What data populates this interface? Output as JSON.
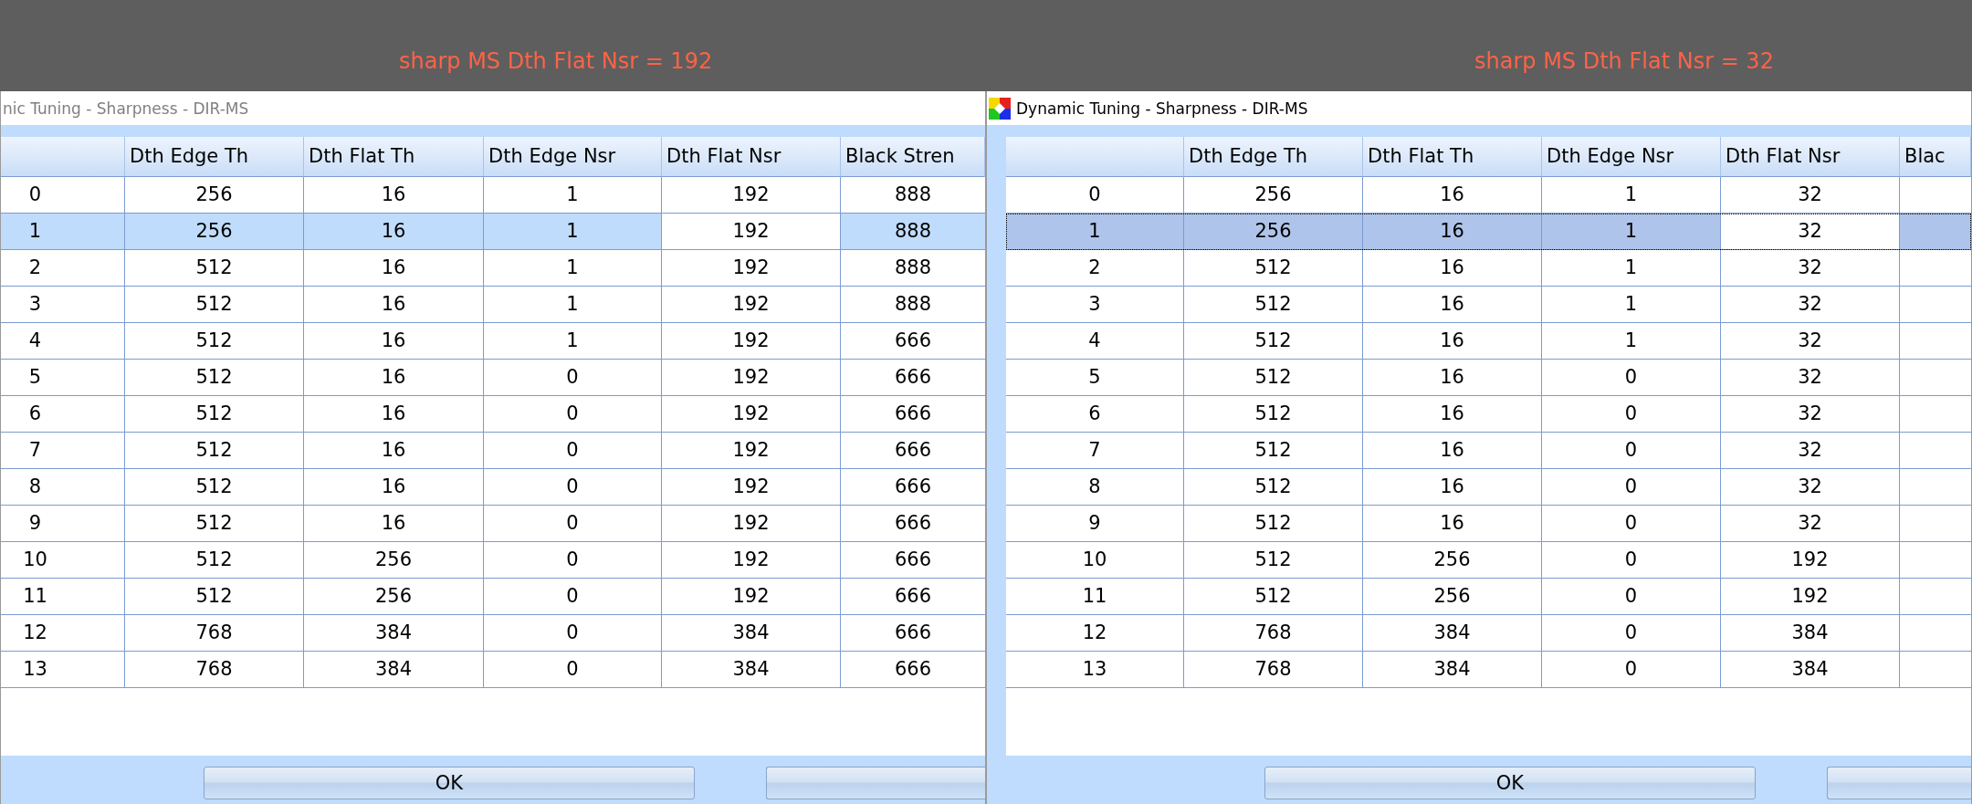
{
  "panels": [
    {
      "caption": "sharp MS Dth Flat Nsr = 192",
      "window": {
        "title": "nic Tuning - Sharpness - DIR-MS",
        "active": false,
        "app_icon": false
      },
      "table": {
        "columns": [
          {
            "label": "Dth Edge Th",
            "current": false
          },
          {
            "label": "Dth Flat Th",
            "current": false
          },
          {
            "label": "Dth Edge Nsr",
            "current": false
          },
          {
            "label": "Dth Flat Nsr",
            "current": true
          },
          {
            "label": "Black Stren",
            "current": false
          }
        ],
        "rows": [
          {
            "header": "0",
            "cells": [
              "256",
              "16",
              "1",
              "192",
              "888"
            ],
            "selected": false
          },
          {
            "header": "1",
            "cells": [
              "256",
              "16",
              "1",
              "192",
              "888"
            ],
            "selected": true
          },
          {
            "header": "2",
            "cells": [
              "512",
              "16",
              "1",
              "192",
              "888"
            ],
            "selected": false
          },
          {
            "header": "3",
            "cells": [
              "512",
              "16",
              "1",
              "192",
              "888"
            ],
            "selected": false
          },
          {
            "header": "4",
            "cells": [
              "512",
              "16",
              "1",
              "192",
              "666"
            ],
            "selected": false
          },
          {
            "header": "5",
            "cells": [
              "512",
              "16",
              "0",
              "192",
              "666"
            ],
            "selected": false
          },
          {
            "header": "6",
            "cells": [
              "512",
              "16",
              "0",
              "192",
              "666"
            ],
            "selected": false
          },
          {
            "header": "7",
            "cells": [
              "512",
              "16",
              "0",
              "192",
              "666"
            ],
            "selected": false
          },
          {
            "header": "8",
            "cells": [
              "512",
              "16",
              "0",
              "192",
              "666"
            ],
            "selected": false
          },
          {
            "header": "9",
            "cells": [
              "512",
              "16",
              "0",
              "192",
              "666"
            ],
            "selected": false
          },
          {
            "header": "10",
            "cells": [
              "512",
              "256",
              "0",
              "192",
              "666"
            ],
            "selected": false
          },
          {
            "header": "11",
            "cells": [
              "512",
              "256",
              "0",
              "192",
              "666"
            ],
            "selected": false
          },
          {
            "header": "12",
            "cells": [
              "768",
              "384",
              "0",
              "384",
              "666"
            ],
            "selected": false
          },
          {
            "header": "13",
            "cells": [
              "768",
              "384",
              "0",
              "384",
              "666"
            ],
            "selected": false
          }
        ]
      },
      "buttons": [
        {
          "kind": "text",
          "label": "OK"
        },
        {
          "kind": "blank"
        }
      ]
    },
    {
      "caption": "sharp MS Dth Flat Nsr = 32",
      "window": {
        "title": "Dynamic Tuning - Sharpness - DIR-MS",
        "active": true,
        "app_icon": true
      },
      "table": {
        "columns": [
          {
            "label": "Dth Edge Th",
            "current": false
          },
          {
            "label": "Dth Flat Th",
            "current": false
          },
          {
            "label": "Dth Edge Nsr",
            "current": false
          },
          {
            "label": "Dth Flat Nsr",
            "current": true
          },
          {
            "label": "Blac",
            "current": false
          }
        ],
        "rows": [
          {
            "header": "0",
            "cells": [
              "256",
              "16",
              "1",
              "32"
            ],
            "selected": false
          },
          {
            "header": "1",
            "cells": [
              "256",
              "16",
              "1",
              "32"
            ],
            "selected": true
          },
          {
            "header": "2",
            "cells": [
              "512",
              "16",
              "1",
              "32"
            ],
            "selected": false
          },
          {
            "header": "3",
            "cells": [
              "512",
              "16",
              "1",
              "32"
            ],
            "selected": false
          },
          {
            "header": "4",
            "cells": [
              "512",
              "16",
              "1",
              "32"
            ],
            "selected": false
          },
          {
            "header": "5",
            "cells": [
              "512",
              "16",
              "0",
              "32"
            ],
            "selected": false
          },
          {
            "header": "6",
            "cells": [
              "512",
              "16",
              "0",
              "32"
            ],
            "selected": false
          },
          {
            "header": "7",
            "cells": [
              "512",
              "16",
              "0",
              "32"
            ],
            "selected": false
          },
          {
            "header": "8",
            "cells": [
              "512",
              "16",
              "0",
              "32"
            ],
            "selected": false
          },
          {
            "header": "9",
            "cells": [
              "512",
              "16",
              "0",
              "32"
            ],
            "selected": false
          },
          {
            "header": "10",
            "cells": [
              "512",
              "256",
              "0",
              "192"
            ],
            "selected": false
          },
          {
            "header": "11",
            "cells": [
              "512",
              "256",
              "0",
              "192"
            ],
            "selected": false
          },
          {
            "header": "12",
            "cells": [
              "768",
              "384",
              "0",
              "384"
            ],
            "selected": false
          },
          {
            "header": "13",
            "cells": [
              "768",
              "384",
              "0",
              "384"
            ],
            "selected": false
          }
        ]
      },
      "buttons": [
        {
          "kind": "text",
          "label": "OK"
        },
        {
          "kind": "blank"
        }
      ]
    }
  ]
}
